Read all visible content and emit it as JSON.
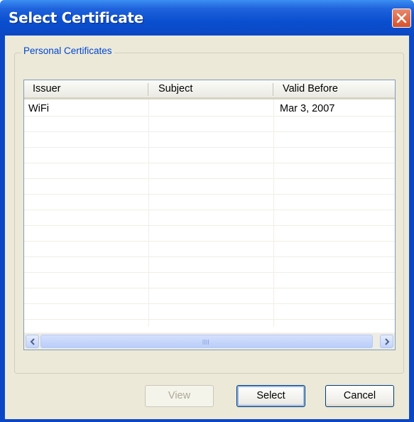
{
  "window": {
    "title": "Select Certificate"
  },
  "group": {
    "label": "Personal Certificates"
  },
  "table": {
    "columns": [
      "Issuer",
      "Subject",
      "Valid Before"
    ],
    "rows": [
      [
        "WiFi",
        "",
        "Mar 3, 2007"
      ]
    ]
  },
  "buttons": {
    "view": "View",
    "select": "Select",
    "cancel": "Cancel"
  },
  "colors": {
    "titlebar": "#0b47c4",
    "dialog_bg": "#ece9d8",
    "group_label": "#0046d5"
  },
  "icons": {
    "close": "close-icon",
    "scroll_left": "chevron-left-icon",
    "scroll_right": "chevron-right-icon"
  }
}
